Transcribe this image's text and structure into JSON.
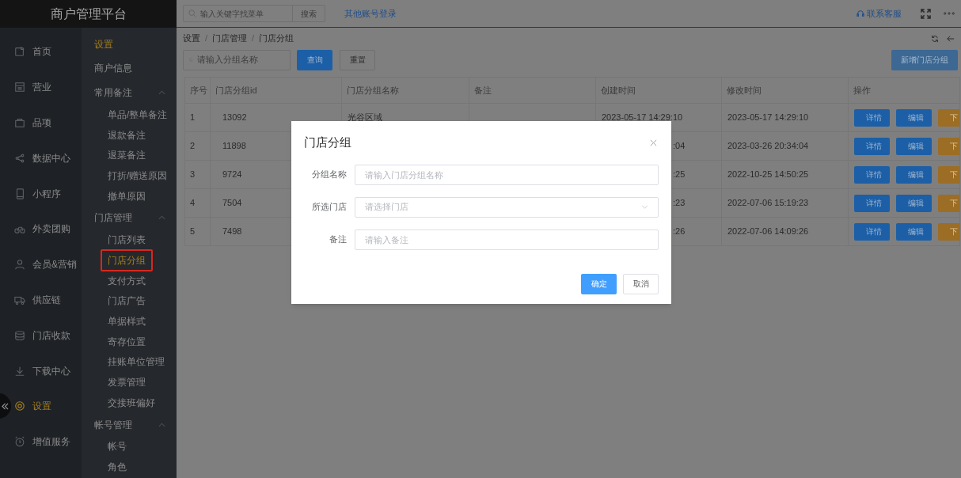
{
  "brand": "商户管理平台",
  "topbar": {
    "search_placeholder": "输入关键字找菜单",
    "search_button": "搜索",
    "other_login": "其他账号登录",
    "support": "联系客服"
  },
  "nav": [
    {
      "label": "首页",
      "selected": false
    },
    {
      "label": "营业",
      "selected": false
    },
    {
      "label": "品项",
      "selected": false
    },
    {
      "label": "数据中心",
      "selected": false
    },
    {
      "label": "小程序",
      "selected": false
    },
    {
      "label": "外卖团购",
      "selected": false
    },
    {
      "label": "会员&营销",
      "selected": false
    },
    {
      "label": "供应链",
      "selected": false
    },
    {
      "label": "门店收款",
      "selected": false
    },
    {
      "label": "下载中心",
      "selected": false
    },
    {
      "label": "设置",
      "selected": true
    },
    {
      "label": "增值服务",
      "selected": false
    }
  ],
  "submenu": {
    "title": "设置",
    "items": [
      {
        "kind": "item",
        "label": "商户信息",
        "selected": false
      },
      {
        "kind": "group",
        "label": "常用备注",
        "expanded": true,
        "children": [
          {
            "label": "单品/整单备注",
            "selected": false
          },
          {
            "label": "退款备注",
            "selected": false
          },
          {
            "label": "退菜备注",
            "selected": false
          },
          {
            "label": "打折/赠送原因",
            "selected": false
          },
          {
            "label": "撤单原因",
            "selected": false
          }
        ]
      },
      {
        "kind": "group",
        "label": "门店管理",
        "expanded": true,
        "children": [
          {
            "label": "门店列表",
            "selected": false
          },
          {
            "label": "门店分组",
            "selected": true
          },
          {
            "label": "支付方式",
            "selected": false
          },
          {
            "label": "门店广告",
            "selected": false
          },
          {
            "label": "单据样式",
            "selected": false
          },
          {
            "label": "寄存位置",
            "selected": false
          },
          {
            "label": "挂账单位管理",
            "selected": false
          },
          {
            "label": "发票管理",
            "selected": false
          },
          {
            "label": "交接班偏好",
            "selected": false
          }
        ]
      },
      {
        "kind": "group",
        "label": "帐号管理",
        "expanded": true,
        "children": [
          {
            "label": "帐号",
            "selected": false
          },
          {
            "label": "角色",
            "selected": false
          }
        ]
      }
    ]
  },
  "breadcrumb": {
    "items": [
      "设置",
      "门店管理",
      "门店分组"
    ],
    "separator": "/"
  },
  "filter": {
    "placeholder": "请输入分组名称",
    "query": "查询",
    "reset": "重置",
    "add": "新增门店分组"
  },
  "table": {
    "columns": [
      "序号",
      "门店分组id",
      "门店分组名称",
      "备注",
      "创建时间",
      "修改时间",
      "操作"
    ],
    "rows": [
      {
        "no": "1",
        "id": "13092",
        "name": "光谷区域",
        "created": "2023-05-17 14:29:10",
        "modified": "2023-05-17 14:29:10",
        "actions": [
          "详情",
          "编辑",
          "下"
        ]
      },
      {
        "no": "2",
        "id": "11898",
        "created": ":04",
        "modified": "2023-03-26 20:34:04",
        "actions": [
          "详情",
          "编辑",
          "下"
        ]
      },
      {
        "no": "3",
        "id": "9724",
        "created": ":25",
        "modified": "2022-10-25 14:50:25",
        "actions": [
          "详情",
          "编辑",
          "下"
        ]
      },
      {
        "no": "4",
        "id": "7504",
        "created": ":23",
        "modified": "2022-07-06 15:19:23",
        "actions": [
          "详情",
          "编辑",
          "下"
        ]
      },
      {
        "no": "5",
        "id": "7498",
        "created": ":26",
        "modified": "2022-07-06 14:09:26",
        "actions": [
          "详情",
          "编辑",
          "下"
        ]
      }
    ]
  },
  "dialog": {
    "title": "门店分组",
    "fields": [
      {
        "kind": "input",
        "label": "分组名称",
        "placeholder": "请输入门店分组名称"
      },
      {
        "kind": "select",
        "label": "所选门店",
        "placeholder": "请选择门店"
      },
      {
        "kind": "input",
        "label": "备注",
        "placeholder": "请输入备注"
      }
    ],
    "confirm": "确定",
    "cancel": "取消"
  }
}
